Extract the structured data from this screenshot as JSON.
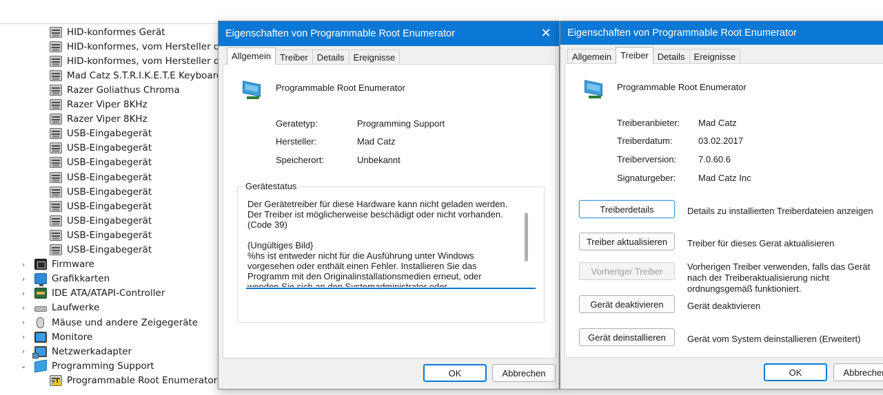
{
  "device_manager": {
    "tree": [
      {
        "label": "HID-konformes Gerät",
        "icon": "hid-device-icon",
        "level": "child"
      },
      {
        "label": "HID-konformes, vom Hersteller de",
        "icon": "hid-device-icon",
        "level": "child"
      },
      {
        "label": "HID-konformes, vom Hersteller de",
        "icon": "hid-device-icon",
        "level": "child"
      },
      {
        "label": "Mad Catz S.T.R.I.K.E.T.E Keyboard",
        "icon": "hid-device-icon",
        "level": "child"
      },
      {
        "label": "Razer Goliathus Chroma",
        "icon": "hid-device-icon",
        "level": "child"
      },
      {
        "label": "Razer Viper 8KHz",
        "icon": "hid-device-icon",
        "level": "child"
      },
      {
        "label": "Razer Viper 8KHz",
        "icon": "hid-device-icon",
        "level": "child"
      },
      {
        "label": "USB-Eingabegerät",
        "icon": "hid-device-icon",
        "level": "child"
      },
      {
        "label": "USB-Eingabegerät",
        "icon": "hid-device-icon",
        "level": "child"
      },
      {
        "label": "USB-Eingabegerät",
        "icon": "hid-device-icon",
        "level": "child"
      },
      {
        "label": "USB-Eingabegerät",
        "icon": "hid-device-icon",
        "level": "child"
      },
      {
        "label": "USB-Eingabegerät",
        "icon": "hid-device-icon",
        "level": "child"
      },
      {
        "label": "USB-Eingabegerät",
        "icon": "hid-device-icon",
        "level": "child"
      },
      {
        "label": "USB-Eingabegerät",
        "icon": "hid-device-icon",
        "level": "child"
      },
      {
        "label": "USB-Eingabegerät",
        "icon": "hid-device-icon",
        "level": "child"
      },
      {
        "label": "USB-Eingabegerät",
        "icon": "hid-device-icon",
        "level": "child"
      },
      {
        "label": "Firmware",
        "icon": "firmware-icon",
        "level": "category",
        "chevron": "›"
      },
      {
        "label": "Grafikkarten",
        "icon": "display-adapter-icon",
        "level": "category",
        "chevron": "›"
      },
      {
        "label": "IDE ATA/ATAPI-Controller",
        "icon": "ide-controller-icon",
        "level": "category",
        "chevron": "›"
      },
      {
        "label": "Laufwerke",
        "icon": "disk-drive-icon",
        "level": "category",
        "chevron": "›"
      },
      {
        "label": "Mäuse und andere Zeigegeräte",
        "icon": "mouse-icon",
        "level": "category",
        "chevron": "›"
      },
      {
        "label": "Monitore",
        "icon": "monitor-icon",
        "level": "category",
        "chevron": "›"
      },
      {
        "label": "Netzwerkadapter",
        "icon": "network-adapter-icon",
        "level": "category",
        "chevron": "›"
      },
      {
        "label": "Programming Support",
        "icon": "programming-support-icon",
        "level": "category",
        "chevron": "⌄"
      },
      {
        "label": "Programmable Root Enumerator",
        "icon": "warning-device-icon",
        "level": "child"
      }
    ]
  },
  "dialog_general": {
    "title": "Eigenschaften von Programmable Root Enumerator",
    "tabs": [
      "Allgemein",
      "Treiber",
      "Details",
      "Ereignisse"
    ],
    "active_tab": "Allgemein",
    "device_name": "Programmable Root Enumerator",
    "properties": [
      {
        "label": "Geratetyp:",
        "value": "Programming Support"
      },
      {
        "label": "Hersteller:",
        "value": "Mad Catz"
      },
      {
        "label": "Speicherort:",
        "value": "Unbekannt"
      }
    ],
    "status_legend": "Gerätestatus",
    "status_lines": [
      "Der Gerätetreiber für diese Hardware kann nicht geladen werden.",
      "Der Treiber ist möglicherweise beschädigt oder nicht vorhanden.",
      "(Code 39)",
      "",
      "{Ungültiges Bild}",
      "%hs ist entweder nicht für die Ausführung unter Windows",
      "vorgesehen oder enthält einen Fehler. Installieren Sie das",
      "Programm mit den Originalinstallationsmedien erneut, oder",
      "wenden Sie sich an den Systemadministrator oder"
    ],
    "ok_label": "OK",
    "cancel_label": "Abbrechen"
  },
  "dialog_driver": {
    "title": "Eigenschaften von Programmable Root Enumerator",
    "tabs": [
      "Allgemein",
      "Treiber",
      "Details",
      "Ereignisse"
    ],
    "active_tab": "Treiber",
    "device_name": "Programmable Root Enumerator",
    "properties": [
      {
        "label": "Treiberanbieter:",
        "value": "Mad Catz"
      },
      {
        "label": "Treiberdatum:",
        "value": "03.02.2017"
      },
      {
        "label": "Treiberversion:",
        "value": "7.0.60.6"
      },
      {
        "label": "Signaturgeber:",
        "value": "Mad Catz Inc"
      }
    ],
    "actions": [
      {
        "button": "Treiberdetails",
        "description": "Details zu installierten Treiberdateien anzeigen",
        "state": "focus"
      },
      {
        "button": "Treiber aktualisieren",
        "description": "Treiber für dieses Gerat aktualisieren",
        "state": "normal"
      },
      {
        "button": "Vorheriger Treiber",
        "description_lines": [
          "Vorherigen Treiber verwenden, falls das Gerät",
          "nach der Treiberaktualisierung nicht",
          "ordnungsgemäß funktioniert."
        ],
        "state": "disabled"
      },
      {
        "button": "Gerät deaktivieren",
        "description": "Gerät deaktivieren",
        "state": "normal"
      },
      {
        "button": "Gerät deinstallieren",
        "description": "Gerät vom System deinstallieren (Erweitert)",
        "state": "normal"
      }
    ],
    "ok_label": "OK",
    "cancel_label": "Abbrechen"
  },
  "colors": {
    "titlebar": "#0a78d4",
    "dialog_bg": "#f0f0f0",
    "panel_bg": "#ffffff",
    "warning": "#f2c200"
  }
}
